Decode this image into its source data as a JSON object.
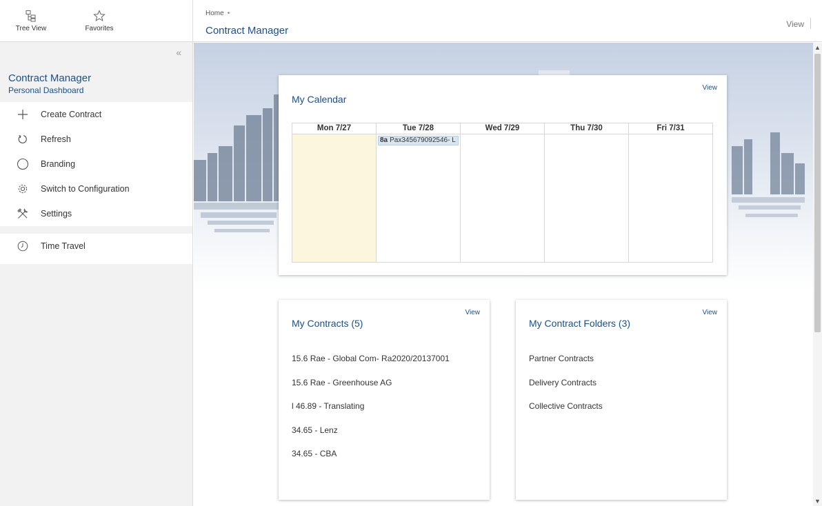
{
  "toolbar": {
    "tree_view_label": "Tree View",
    "favorites_label": "Favorites"
  },
  "sidebar": {
    "title": "Contract Manager",
    "subtitle": "Personal Dashboard",
    "collapse_glyph": "«",
    "items": [
      {
        "label": "Create Contract",
        "icon": "plus-icon"
      },
      {
        "label": "Refresh",
        "icon": "refresh-icon"
      },
      {
        "label": "Branding",
        "icon": "circle-icon"
      },
      {
        "label": "Switch to Configuration",
        "icon": "gear-icon"
      },
      {
        "label": "Settings",
        "icon": "tools-icon"
      }
    ],
    "secondary_items": [
      {
        "label": "Time Travel",
        "icon": "clock-icon"
      }
    ]
  },
  "header": {
    "breadcrumb": "Home",
    "breadcrumb_separator": "•",
    "title": "Contract Manager",
    "view_label": "View"
  },
  "calendar": {
    "title": "My Calendar",
    "view_label": "View",
    "days": [
      "Mon 7/27",
      "Tue 7/28",
      "Wed 7/29",
      "Thu 7/30",
      "Fri 7/31"
    ],
    "event": {
      "time": "8a",
      "text": "Pax345679092546- L"
    }
  },
  "contracts": {
    "title": "My Contracts (5)",
    "view_label": "View",
    "items": [
      "15.6 Rae - Global Com- Ra2020/20137001",
      "15.6 Rae - Greenhouse AG",
      "l 46.89 - Translating",
      "34.65 - Lenz",
      "34.65 - CBA"
    ]
  },
  "folders": {
    "title": "My Contract Folders (3)",
    "view_label": "View",
    "items": [
      "Partner Contracts",
      "Delivery Contracts",
      "Collective Contracts"
    ]
  },
  "colors": {
    "accent": "#1b4f8a",
    "today_highlight": "#fbf6dc",
    "event_fill": "#d9e6f2"
  }
}
